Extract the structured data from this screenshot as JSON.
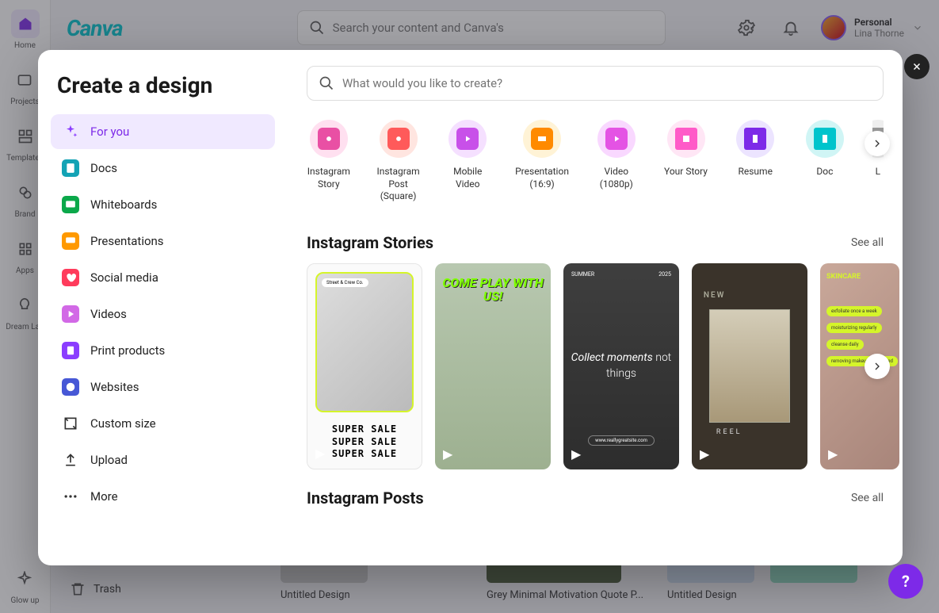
{
  "bg": {
    "sidebar": [
      {
        "label": "Home",
        "active": true
      },
      {
        "label": "Projects"
      },
      {
        "label": "Templates"
      },
      {
        "label": "Brand"
      },
      {
        "label": "Apps"
      },
      {
        "label": "Dream Lab"
      },
      {
        "label": "Glow up"
      }
    ],
    "logo": "Canva",
    "search_placeholder": "Search your content and Canva's",
    "user": {
      "plan": "Personal",
      "name": "Lina Thorne"
    },
    "trash": "Trash",
    "recent": [
      {
        "title": "Untitled Design"
      },
      {
        "title": "Grey Minimal Motivation Quote P..."
      },
      {
        "title": "Untitled Design"
      }
    ]
  },
  "modal": {
    "title": "Create a design",
    "search_placeholder": "What would you like to create?",
    "nav": [
      {
        "label": "For you",
        "icon_bg": "#8b3dff",
        "active": true
      },
      {
        "label": "Docs",
        "icon_bg": "#13a3b5"
      },
      {
        "label": "Whiteboards",
        "icon_bg": "#0ba84a"
      },
      {
        "label": "Presentations",
        "icon_bg": "#ff9900"
      },
      {
        "label": "Social media",
        "icon_bg": "#ff3b5c"
      },
      {
        "label": "Videos",
        "icon_bg": "#d269e6"
      },
      {
        "label": "Print products",
        "icon_bg": "#8b3dff"
      },
      {
        "label": "Websites",
        "icon_bg": "#4758d6"
      },
      {
        "label": "Custom size",
        "icon_bg": "transparent"
      },
      {
        "label": "Upload",
        "icon_bg": "transparent"
      },
      {
        "label": "More",
        "icon_bg": "transparent"
      }
    ],
    "types": [
      {
        "label": "Instagram Story",
        "outer": "#ffe0f0",
        "inner": "#e950a4"
      },
      {
        "label": "Instagram Post (Square)",
        "outer": "#ffe5e0",
        "inner": "#ff5a5a"
      },
      {
        "label": "Mobile Video",
        "outer": "#f5e0ff",
        "inner": "#c850e9"
      },
      {
        "label": "Presentation (16:9)",
        "outer": "#fff3d6",
        "inner": "#ff8a00"
      },
      {
        "label": "Video (1080p)",
        "outer": "#f9d8ff",
        "inner": "#e453e4"
      },
      {
        "label": "Your Story",
        "outer": "#ffe6f5",
        "inner": "#ff5ac8"
      },
      {
        "label": "Resume",
        "outer": "#ece4ff",
        "inner": "#7d2ae8"
      },
      {
        "label": "Doc",
        "outer": "#d0f5f5",
        "inner": "#00c4cc"
      },
      {
        "label": "L",
        "outer": "#eee",
        "inner": "#999"
      }
    ],
    "sections": {
      "stories": {
        "title": "Instagram Stories",
        "see_all": "See all"
      },
      "posts": {
        "title": "Instagram Posts",
        "see_all": "See all"
      }
    },
    "story_cards": {
      "c1_badge": "Street & Crew Co.",
      "c1_text": "SUPER SALE\nSUPER SALE\nSUPER SALE",
      "c2_text": "COME PLAY WITH US!",
      "c3_top_left": "SUMMER",
      "c3_top_right": "2025",
      "c3_text_1": "Collect moments",
      "c3_text_2": "not",
      "c3_text_3": "things",
      "c3_url": "www.reallygreatsite.com",
      "c4_new": "NEW",
      "c4_reel": "REEL",
      "c5_title": "SKINCARE",
      "c5_pills": [
        "exfoliate once a week",
        "moisturizing regularly",
        "cleanse daily",
        "removing makeup before bed"
      ]
    }
  },
  "help": "?"
}
